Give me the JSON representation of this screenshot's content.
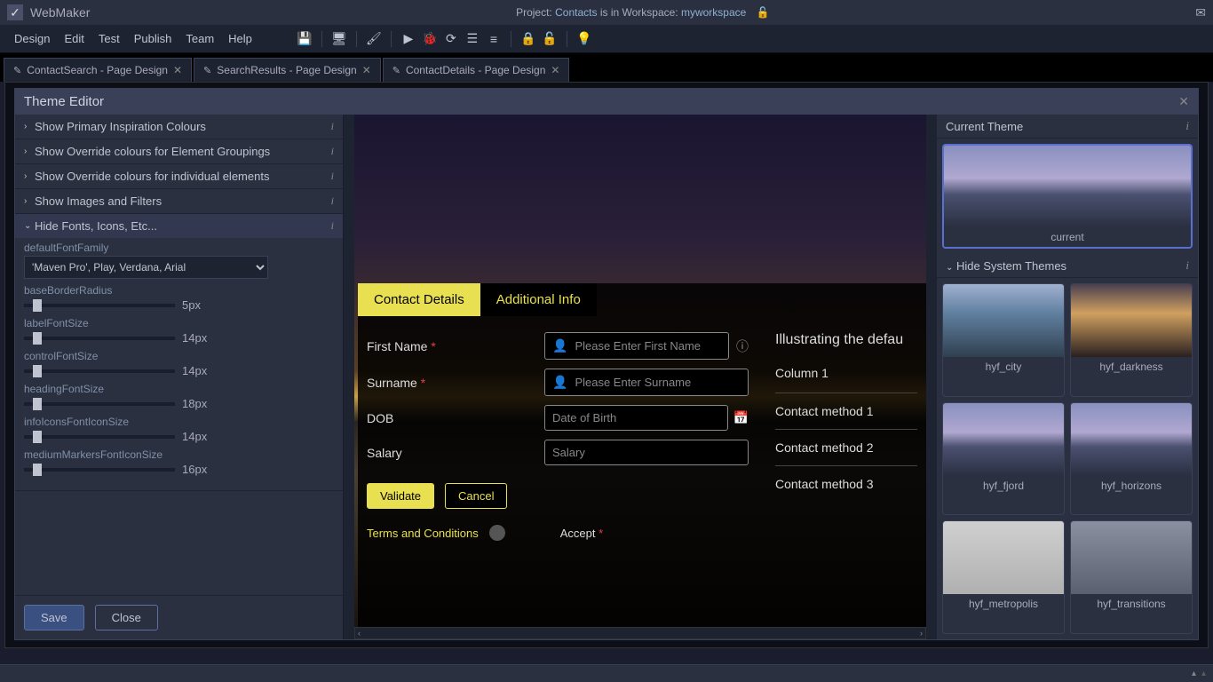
{
  "app": {
    "name": "WebMaker"
  },
  "project": {
    "prefix": "Project:",
    "name": "Contacts",
    "mid": "is in Workspace:",
    "workspace": "myworkspace"
  },
  "menu": [
    "Design",
    "Edit",
    "Test",
    "Publish",
    "Team",
    "Help"
  ],
  "docTabs": [
    {
      "label": "ContactSearch - Page Design"
    },
    {
      "label": "SearchResults - Page Design"
    },
    {
      "label": "ContactDetails - Page Design"
    }
  ],
  "themeEditor": {
    "title": "Theme Editor",
    "sections": [
      {
        "label": "Show Primary Inspiration Colours",
        "open": false
      },
      {
        "label": "Show Override colours for Element Groupings",
        "open": false
      },
      {
        "label": "Show Override colours for individual elements",
        "open": false
      },
      {
        "label": "Show Images and Filters",
        "open": false
      },
      {
        "label": "Hide Fonts, Icons, Etc...",
        "open": true
      }
    ],
    "fontProp": {
      "label": "defaultFontFamily",
      "value": "'Maven Pro', Play, Verdana, Arial"
    },
    "sliders": [
      {
        "label": "baseBorderRadius",
        "value": "5px"
      },
      {
        "label": "labelFontSize",
        "value": "14px"
      },
      {
        "label": "controlFontSize",
        "value": "14px"
      },
      {
        "label": "headingFontSize",
        "value": "18px"
      },
      {
        "label": "infoIconsFontIconSize",
        "value": "14px"
      },
      {
        "label": "mediumMarkersFontIconSize",
        "value": "16px"
      }
    ],
    "buttons": {
      "save": "Save",
      "close": "Close"
    }
  },
  "preview": {
    "tabs": [
      "Contact Details",
      "Additional Info"
    ],
    "fields": {
      "firstName": {
        "label": "First Name",
        "required": true,
        "placeholder": "Please Enter First Name"
      },
      "surname": {
        "label": "Surname",
        "required": true,
        "placeholder": "Please Enter Surname"
      },
      "dob": {
        "label": "DOB",
        "required": false,
        "placeholder": "Date of Birth"
      },
      "salary": {
        "label": "Salary",
        "required": false,
        "placeholder": "Salary"
      }
    },
    "buttons": {
      "validate": "Validate",
      "cancel": "Cancel"
    },
    "terms": {
      "label": "Terms and Conditions",
      "accept": "Accept",
      "acceptRequired": true
    },
    "right": {
      "heading": "Illustrating the defau",
      "column": "Column 1",
      "rows": [
        "Contact method 1",
        "Contact method 2",
        "Contact method 3"
      ]
    }
  },
  "themes": {
    "currentHead": "Current Theme",
    "currentLabel": "current",
    "systemHead": "Hide System Themes",
    "list": [
      {
        "label": "hyf_city",
        "cls": "city"
      },
      {
        "label": "hyf_darkness",
        "cls": "dark"
      },
      {
        "label": "hyf_fjord",
        "cls": ""
      },
      {
        "label": "hyf_horizons",
        "cls": ""
      },
      {
        "label": "hyf_metropolis",
        "cls": "metro"
      },
      {
        "label": "hyf_transitions",
        "cls": "trans"
      }
    ]
  }
}
